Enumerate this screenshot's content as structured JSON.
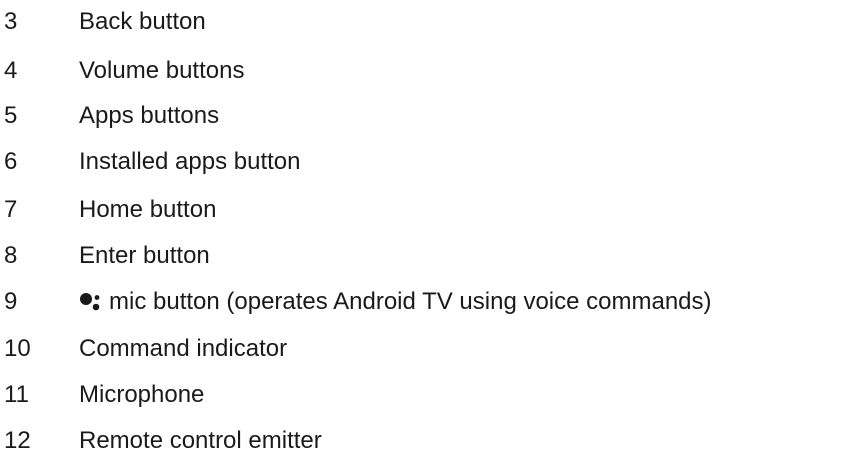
{
  "legend": {
    "items": [
      {
        "number": "3",
        "label": "Back button"
      },
      {
        "number": "4",
        "label": "Volume buttons"
      },
      {
        "number": "5",
        "label": "Apps buttons"
      },
      {
        "number": "6",
        "label": "Installed apps button"
      },
      {
        "number": "7",
        "label": "Home button"
      },
      {
        "number": "8",
        "label": "Enter button"
      },
      {
        "number": "9",
        "label": "mic button (operates Android TV using voice commands)",
        "icon": "google-assistant-icon"
      },
      {
        "number": "10",
        "label": "Command indicator"
      },
      {
        "number": "11",
        "label": "Microphone"
      },
      {
        "number": "12",
        "label": "Remote control emitter"
      }
    ]
  }
}
